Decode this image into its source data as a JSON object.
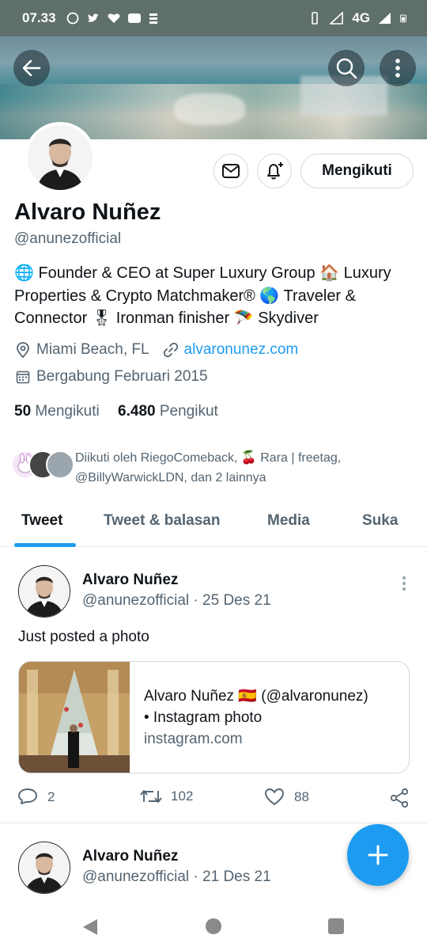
{
  "status_bar": {
    "time": "07.33",
    "network": "4G"
  },
  "profile": {
    "name": "Alvaro Nuñez",
    "handle": "@anunezofficial",
    "follow_button": "Mengikuti",
    "bio_line1": "🌐 Founder & CEO at Super Luxury Group 🏠 Luxury",
    "bio_line2": "Properties & Crypto Matchmaker® 🌎 Traveler &",
    "bio_line3": "Connector 🎖 Ironman finisher 🪂 Skydiver",
    "location": "Miami Beach, FL",
    "website": "alvaronunez.com",
    "joined": "Bergabung Februari 2015",
    "following_count": "50",
    "following_label": "Mengikuti",
    "followers_count": "6.480",
    "followers_label": "Pengikut",
    "followed_by_line1": "Diikuti oleh RiegoComeback, 🍒 Rara | freetag,",
    "followed_by_line2": "@BillyWarwickLDN, dan 2 lainnya"
  },
  "tabs": [
    "Tweet",
    "Tweet & balasan",
    "Media",
    "Suka"
  ],
  "tweets": [
    {
      "name": "Alvaro Nuñez",
      "handle": "@anunezofficial",
      "date": "25 Des 21",
      "text": "Just posted a photo",
      "card_title_line1": "Alvaro Nuñez 🇪🇸 (@alvaronunez)",
      "card_title_line2": "• Instagram photo",
      "card_domain": "instagram.com",
      "replies": "2",
      "retweets": "102",
      "likes": "88"
    },
    {
      "name": "Alvaro Nuñez",
      "handle": "@anunezofficial",
      "date": "21 Des 21"
    }
  ],
  "colors": {
    "accent": "#1d9bf0",
    "text": "#0f1419",
    "secondary": "#536471"
  }
}
